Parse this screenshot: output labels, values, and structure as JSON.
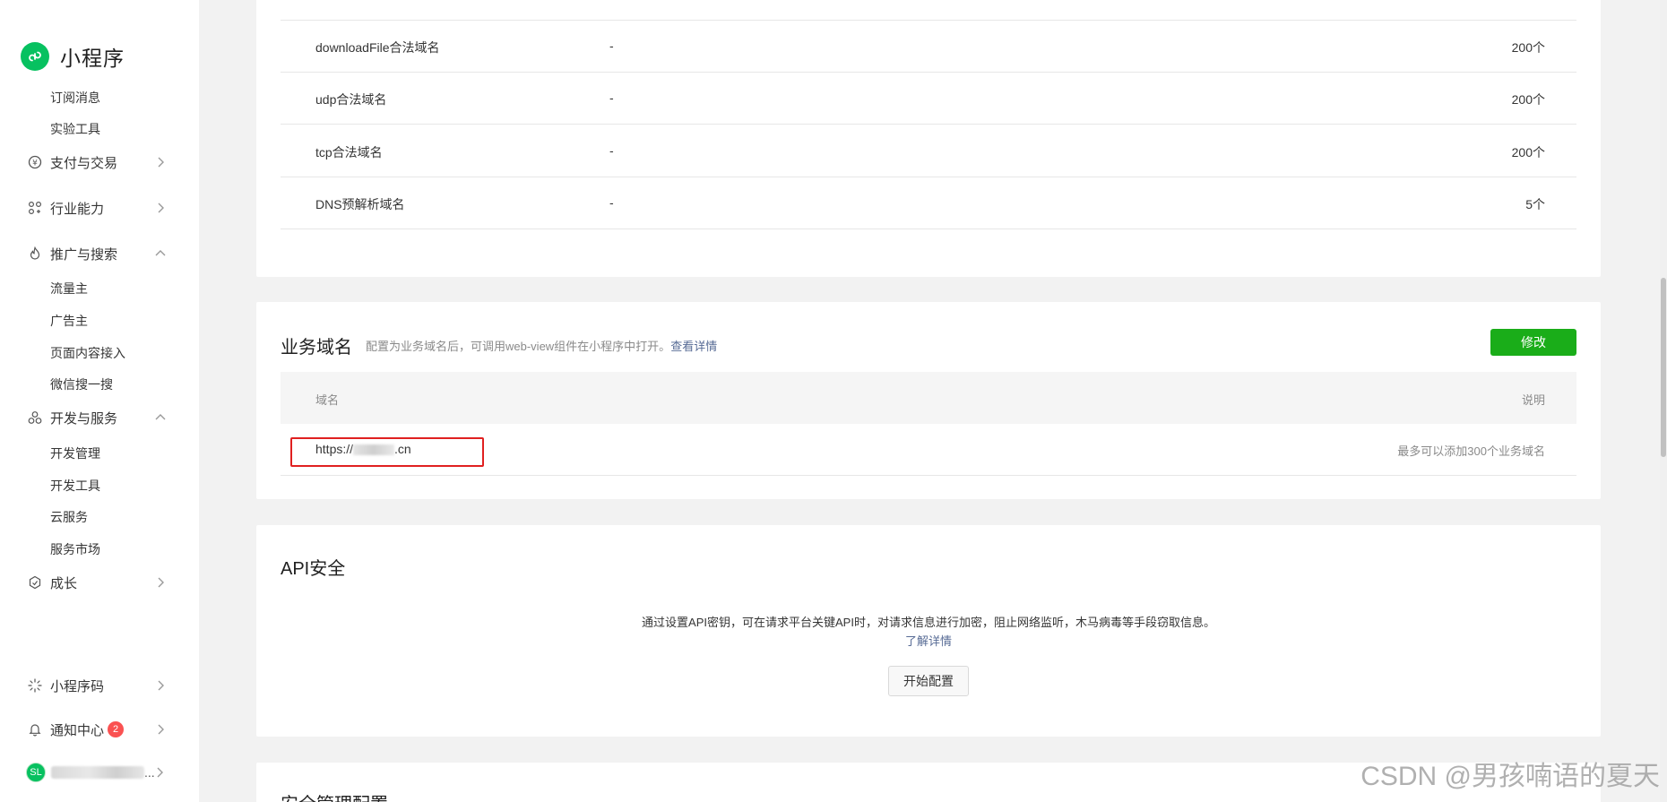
{
  "brand": {
    "name": "小程序"
  },
  "sidebar": {
    "subs_top": [
      "订阅消息",
      "实验工具"
    ],
    "payment": {
      "label": "支付与交易"
    },
    "industry": {
      "label": "行业能力"
    },
    "promotion": {
      "label": "推广与搜索",
      "items": [
        "流量主",
        "广告主",
        "页面内容接入",
        "微信搜一搜"
      ]
    },
    "dev": {
      "label": "开发与服务",
      "items": [
        "开发管理",
        "开发工具",
        "云服务",
        "服务市场"
      ]
    },
    "growth": {
      "label": "成长"
    },
    "qrcode": {
      "label": "小程序码"
    },
    "notify": {
      "label": "通知中心",
      "badge": "2"
    },
    "user": {
      "avatar": "SL",
      "name_suffix": "..."
    }
  },
  "server_domains": {
    "rows": [
      {
        "name": "downloadFile合法域名",
        "value": "-",
        "limit": "200个"
      },
      {
        "name": "udp合法域名",
        "value": "-",
        "limit": "200个"
      },
      {
        "name": "tcp合法域名",
        "value": "-",
        "limit": "200个"
      },
      {
        "name": "DNS预解析域名",
        "value": "-",
        "limit": "5个"
      }
    ]
  },
  "business_domain": {
    "title": "业务域名",
    "desc": "配置为业务域名后，可调用web-view组件在小程序中打开。",
    "detail_link": "查看详情",
    "edit_button": "修改",
    "col_domain": "域名",
    "col_note": "说明",
    "domain_prefix": "https://",
    "domain_suffix": ".cn",
    "note": "最多可以添加300个业务域名"
  },
  "api_security": {
    "title": "API安全",
    "desc": "通过设置API密钥，可在请求平台关键API时，对请求信息进行加密，阻止网络监听，木马病毒等手段窃取信息。",
    "learn_more": "了解详情",
    "start_button": "开始配置"
  },
  "next_section": {
    "title": "安全管理配置"
  },
  "watermark": "CSDN @男孩喃语的夏天",
  "colors": {
    "brand_green": "#07c160",
    "button_green": "#1aad19",
    "link": "#576b95",
    "highlight_red": "#e02020",
    "badge_red": "#fa5151"
  }
}
